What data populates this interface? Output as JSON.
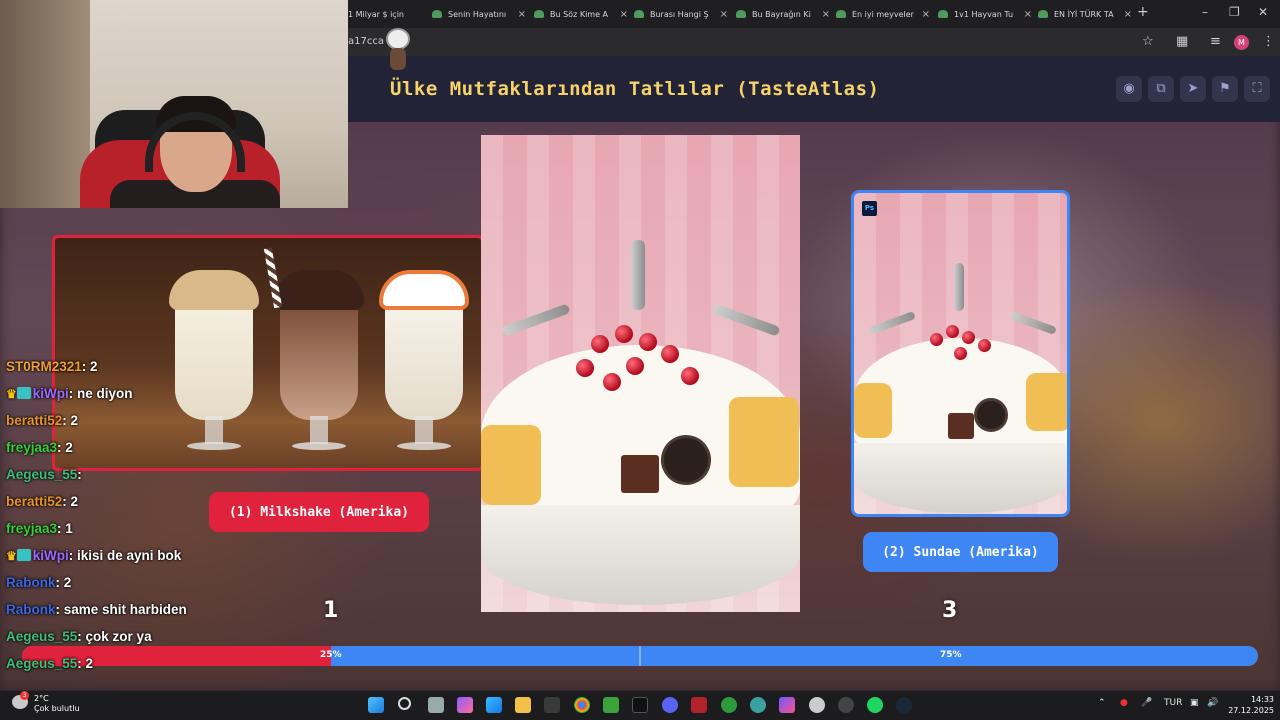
{
  "browser": {
    "tabs": [
      {
        "label": "1 Milyar $ için",
        "has_favicon": false
      },
      {
        "label": "Senin Hayatını",
        "has_favicon": true
      },
      {
        "label": "Bu Söz Kime A",
        "has_favicon": true
      },
      {
        "label": "Burası Hangi Ş",
        "has_favicon": true
      },
      {
        "label": "Bu Bayrağın Ki",
        "has_favicon": true
      },
      {
        "label": "En iyi meyveler",
        "has_favicon": true
      },
      {
        "label": "1v1 Hayvan Tu",
        "has_favicon": true
      },
      {
        "label": "EN İYİ TÜRK TA",
        "has_favicon": true
      }
    ],
    "address_fragment": "a17cca",
    "profile_initial": "M"
  },
  "page": {
    "title": "Ülke Mutfaklarından Tatlılar (TasteAtlas)",
    "header_icons": [
      "eye-icon",
      "copy-icon",
      "send-icon",
      "flag-icon",
      "fullscreen-icon"
    ]
  },
  "battle": {
    "left": {
      "label": "(1) Milkshake (Amerika)",
      "rank": "1",
      "percent_text": "25%",
      "color": "#e0223d"
    },
    "right": {
      "label": "(2) Sundae (Amerika)",
      "rank": "3",
      "percent_text": "75%",
      "color": "#3f86f5"
    },
    "split_fraction": 0.25,
    "ps_badge": "Ps"
  },
  "chat": [
    {
      "user": "ST0RM2321",
      "msg": "2",
      "color": "#f0a030",
      "crown": false
    },
    {
      "user": "kiWpi",
      "msg": "ne diyon",
      "color": "#9b6bff",
      "crown": true
    },
    {
      "user": "beratti52",
      "msg": "2",
      "color": "#e8942c",
      "crown": false
    },
    {
      "user": "freyjaa3",
      "msg": "2",
      "color": "#35d13a",
      "crown": false
    },
    {
      "user": "Aegeus_55",
      "msg": "",
      "color": "#3dbf7a",
      "crown": false
    },
    {
      "user": "beratti52",
      "msg": "2",
      "color": "#e8942c",
      "crown": false
    },
    {
      "user": "freyjaa3",
      "msg": "1",
      "color": "#35d13a",
      "crown": false
    },
    {
      "user": "kiWpi",
      "msg": "ikisi de ayni bok",
      "color": "#9b6bff",
      "crown": true
    },
    {
      "user": "Rabonk",
      "msg": "2",
      "color": "#3a67e0",
      "crown": false
    },
    {
      "user": "Rabonk",
      "msg": "same shit harbiden",
      "color": "#3a67e0",
      "crown": false
    },
    {
      "user": "Aegeus_55",
      "msg": "çok zor ya",
      "color": "#3dbf7a",
      "crown": false
    },
    {
      "user": "Aegeus_55",
      "msg": "2",
      "color": "#3dbf7a",
      "crown": false
    }
  ],
  "taskbar": {
    "weather_temp": "2°C",
    "weather_desc": "Çok bulutlu",
    "weather_badge": "3",
    "language": "TUR",
    "time": "14:33",
    "date": "27.12.2025"
  }
}
